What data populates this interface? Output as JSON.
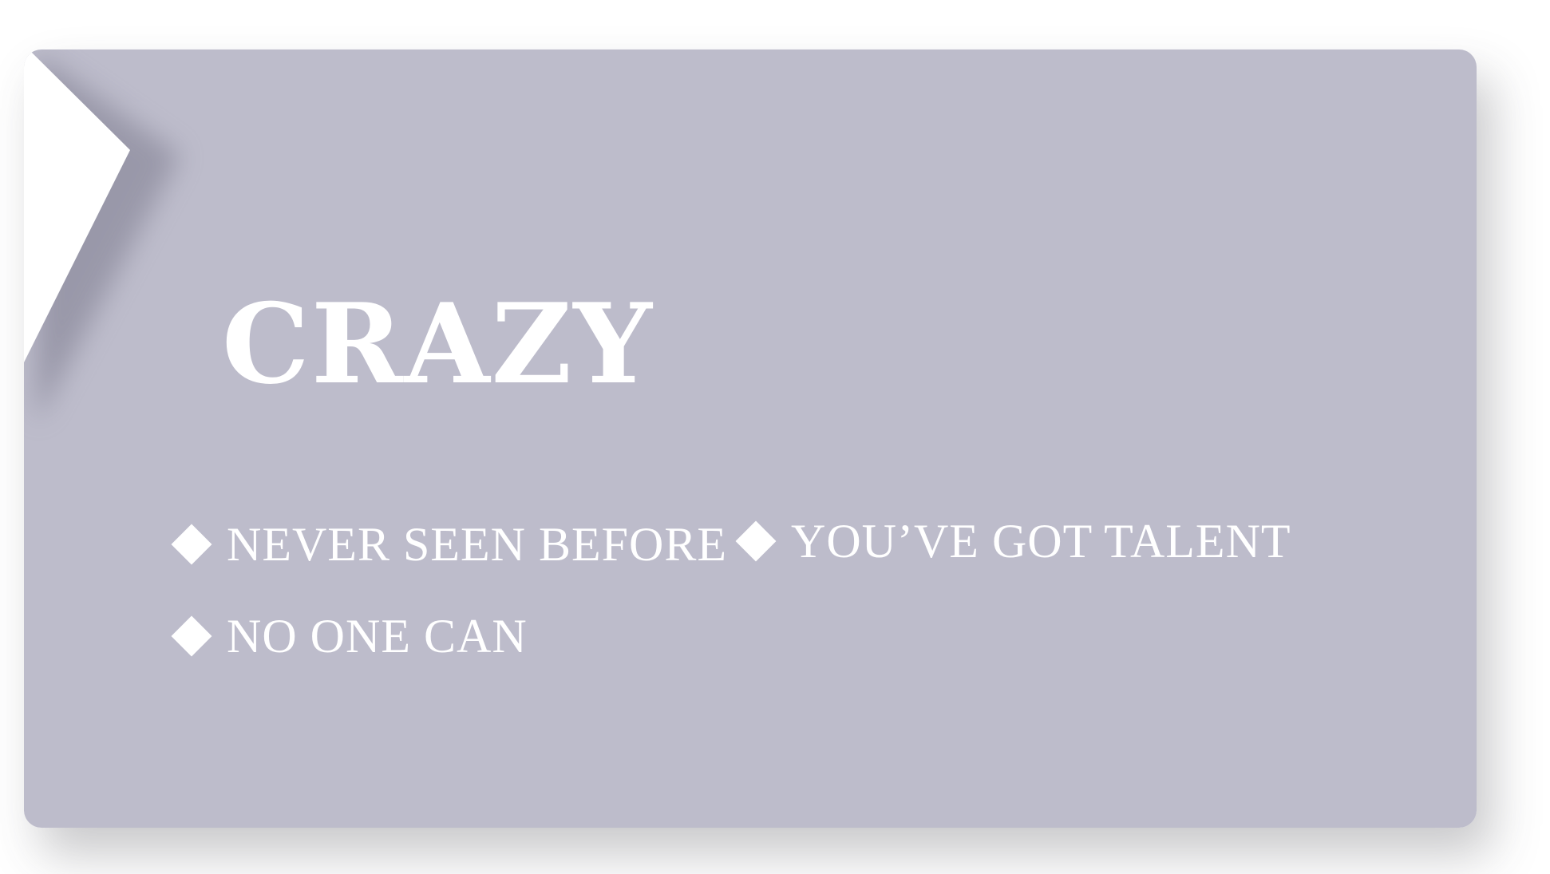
{
  "slide": {
    "title": "CRAZY",
    "bullets": [
      {
        "text": "NEVER SEEN BEFORE",
        "icon": "diamond-bullet-icon"
      },
      {
        "text": "YOU’VE GOT TALENT",
        "icon": "diamond-bullet-icon"
      },
      {
        "text": "NO ONE CAN",
        "icon": "diamond-bullet-icon"
      }
    ]
  },
  "colors": {
    "card": "#bdbccb",
    "text": "#ffffff",
    "background": "#ffffff"
  }
}
